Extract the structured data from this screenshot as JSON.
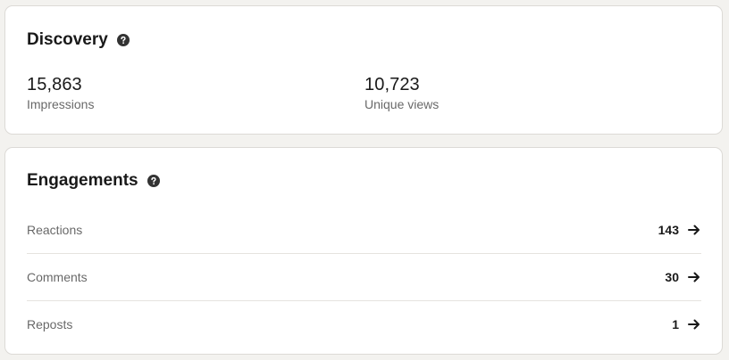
{
  "discovery": {
    "title": "Discovery",
    "help_icon": "question-circle-icon",
    "metrics": [
      {
        "value": "15,863",
        "label": "Impressions"
      },
      {
        "value": "10,723",
        "label": "Unique views"
      }
    ]
  },
  "engagements": {
    "title": "Engagements",
    "help_icon": "question-circle-icon",
    "rows": [
      {
        "label": "Reactions",
        "count": "143",
        "icon": "arrow-right-icon"
      },
      {
        "label": "Comments",
        "count": "30",
        "icon": "arrow-right-icon"
      },
      {
        "label": "Reposts",
        "count": "1",
        "icon": "arrow-right-icon"
      }
    ]
  },
  "colors": {
    "page_background": "#f3f2ef",
    "card_background": "#ffffff",
    "card_border": "#dcdad6",
    "primary_text": "#191919",
    "secondary_text": "#666666"
  }
}
